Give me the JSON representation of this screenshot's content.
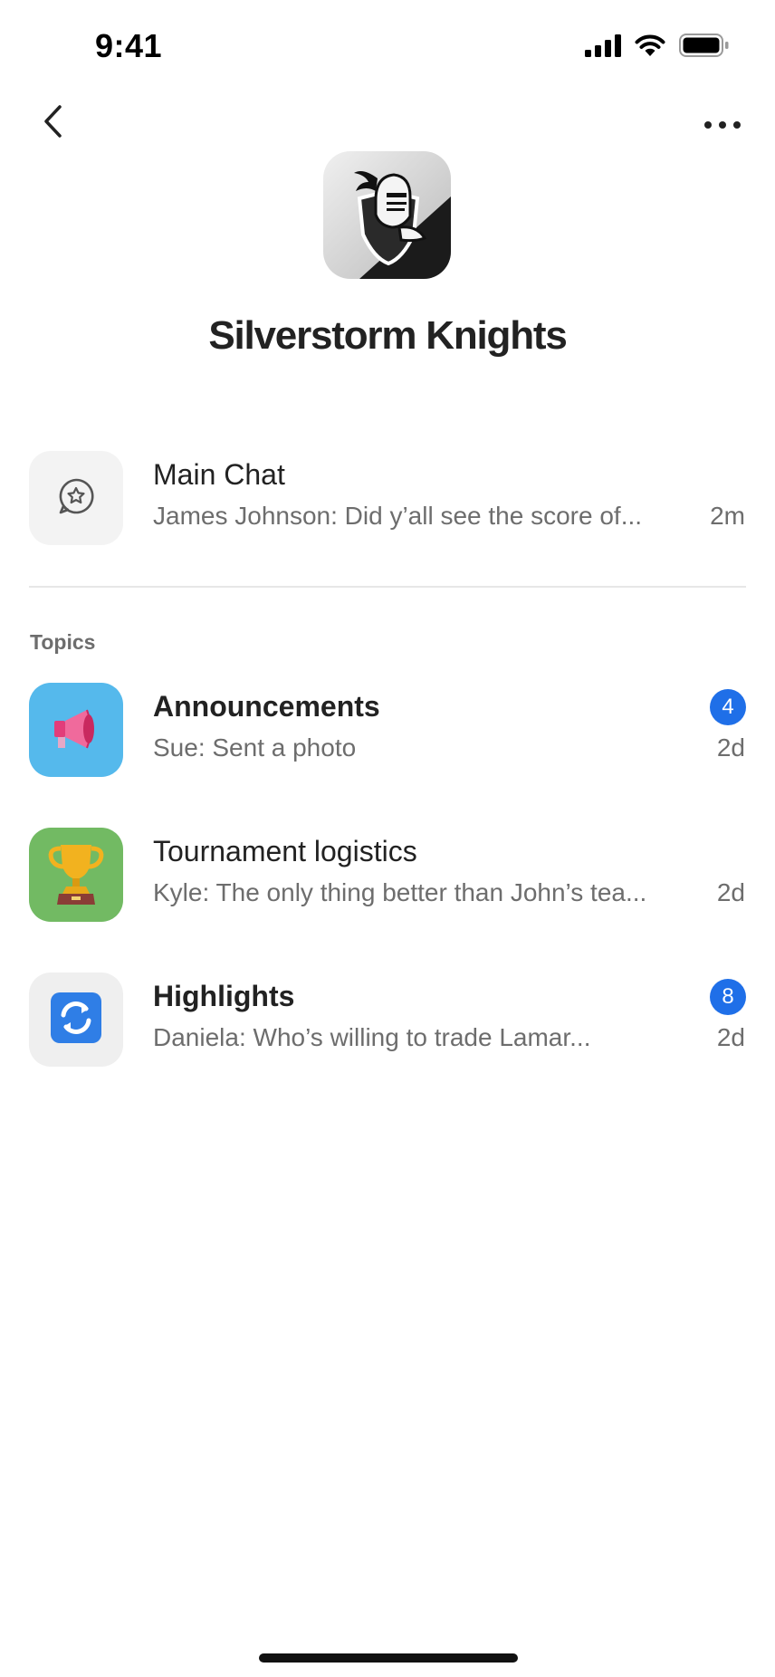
{
  "status_bar": {
    "time": "9:41"
  },
  "header": {
    "group_name": "Silverstorm Knights"
  },
  "main_chat": {
    "title": "Main Chat",
    "preview": "James Johnson: Did y’all see the score of...",
    "time": "2m"
  },
  "topics": {
    "section_label": "Topics",
    "items": [
      {
        "title": "Announcements",
        "preview": "Sue: Sent a photo",
        "time": "2d",
        "badge": "4",
        "icon": "megaphone-icon",
        "icon_bg": "#55b9ec"
      },
      {
        "title": "Tournament logistics",
        "preview": "Kyle: The only thing better than John’s tea...",
        "time": "2d",
        "badge": "",
        "icon": "trophy-icon",
        "icon_bg": "#72ba63"
      },
      {
        "title": "Highlights",
        "preview": "Daniela: Who’s willing to trade Lamar...",
        "time": "2d",
        "badge": "8",
        "icon": "refresh-icon",
        "icon_bg": "#efefef"
      }
    ]
  },
  "colors": {
    "badge": "#1f6fe8",
    "secondary_text": "#6d6d6d",
    "primary_text": "#222222"
  }
}
